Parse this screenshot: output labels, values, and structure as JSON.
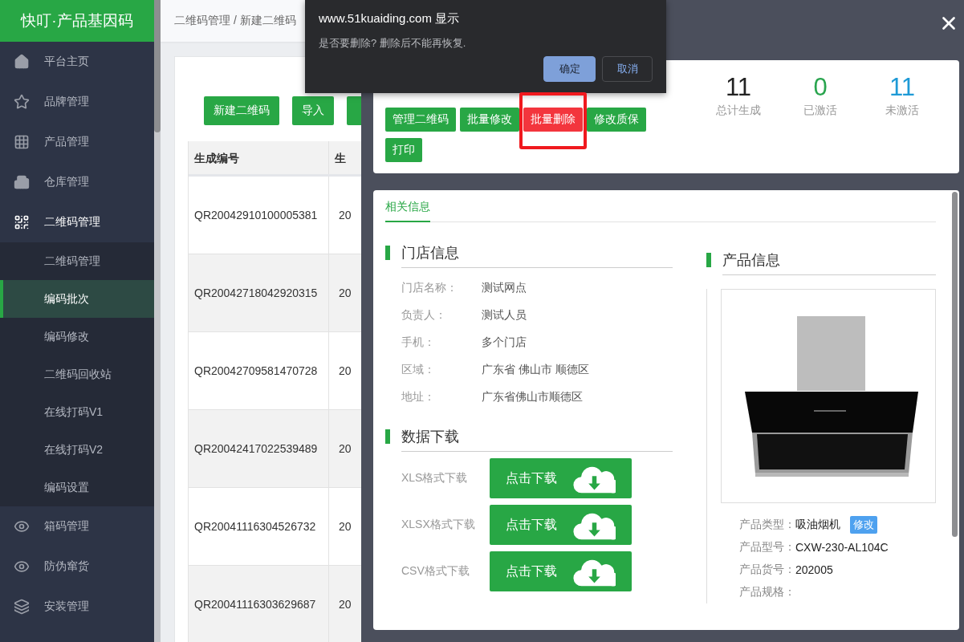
{
  "sidebar": {
    "title": "快叮·产品基因码",
    "items": [
      {
        "label": "平台主页",
        "expanded": false
      },
      {
        "label": "品牌管理",
        "expanded": false
      },
      {
        "label": "产品管理",
        "expanded": false
      },
      {
        "label": "仓库管理",
        "expanded": false
      },
      {
        "label": "二维码管理",
        "expanded": true,
        "children": [
          {
            "label": "二维码管理",
            "selected": false
          },
          {
            "label": "编码批次",
            "selected": true
          },
          {
            "label": "编码修改",
            "selected": false
          },
          {
            "label": "二维码回收站",
            "selected": false
          },
          {
            "label": "在线打码V1",
            "selected": false
          },
          {
            "label": "在线打码V2",
            "selected": false
          },
          {
            "label": "编码设置",
            "selected": false
          }
        ]
      },
      {
        "label": "箱码管理",
        "expanded": false
      },
      {
        "label": "防伪窜货",
        "expanded": false
      },
      {
        "label": "安装管理",
        "expanded": false
      }
    ]
  },
  "breadcrumb": "二维码管理 / 新建二维码",
  "toolbar": [
    {
      "label": "新建二维码"
    },
    {
      "label": "导入"
    }
  ],
  "table": {
    "columns": [
      "生成编号",
      "生"
    ],
    "rows": [
      [
        "QR20042910100005381",
        "20"
      ],
      [
        "QR20042718042920315",
        "20"
      ],
      [
        "QR20042709581470728",
        "20"
      ],
      [
        "QR20042417022539489",
        "20"
      ],
      [
        "QR20041116304526732",
        "20"
      ],
      [
        "QR20041116303629687",
        "20"
      ]
    ]
  },
  "drawer": {
    "actions": [
      {
        "label": "管理二维码",
        "kind": "normal",
        "highlighted": false
      },
      {
        "label": "批量修改",
        "kind": "normal",
        "highlighted": false
      },
      {
        "label": "批量删除",
        "kind": "danger",
        "highlighted": true
      },
      {
        "label": "修改质保",
        "kind": "normal",
        "highlighted": false
      },
      {
        "label": "打印",
        "kind": "normal",
        "highlighted": false
      }
    ],
    "stats": [
      {
        "value": "11",
        "label": "总计生成",
        "color": "#222222"
      },
      {
        "value": "0",
        "label": "已激活",
        "color": "#2aa54f"
      },
      {
        "value": "11",
        "label": "未激活",
        "color": "#1e9ad6"
      }
    ],
    "tabs": [
      {
        "label": "相关信息",
        "selected": true
      }
    ],
    "store": {
      "title": "门店信息",
      "fields": [
        {
          "label": "门店名称：",
          "value": "测试网点"
        },
        {
          "label": "负责人：",
          "value": "测试人员"
        },
        {
          "label": "手机：",
          "value": "多个门店"
        },
        {
          "label": "区域：",
          "value": "广东省 佛山市 顺德区"
        },
        {
          "label": "地址：",
          "value": "广东省佛山市顺德区"
        }
      ]
    },
    "download": {
      "title": "数据下载",
      "rows": [
        {
          "label": "XLS格式下载",
          "button": "点击下载"
        },
        {
          "label": "XLSX格式下载",
          "button": "点击下载"
        },
        {
          "label": "CSV格式下载",
          "button": "点击下载"
        }
      ]
    },
    "product": {
      "title": "产品信息",
      "fields": [
        {
          "label": "产品类型：",
          "value": "吸油烟机",
          "badge": "修改"
        },
        {
          "label": "产品型号：",
          "value": "CXW-230-AL104C"
        },
        {
          "label": "产品货号：",
          "value": "202005"
        },
        {
          "label": "产品规格："
        }
      ]
    }
  },
  "dialog": {
    "title": "www.51kuaiding.com 显示",
    "message": "是否要删除? 删除后不能再恢复.",
    "buttons": [
      {
        "label": "确定",
        "selected": true
      },
      {
        "label": "取消",
        "selected": false
      }
    ]
  }
}
